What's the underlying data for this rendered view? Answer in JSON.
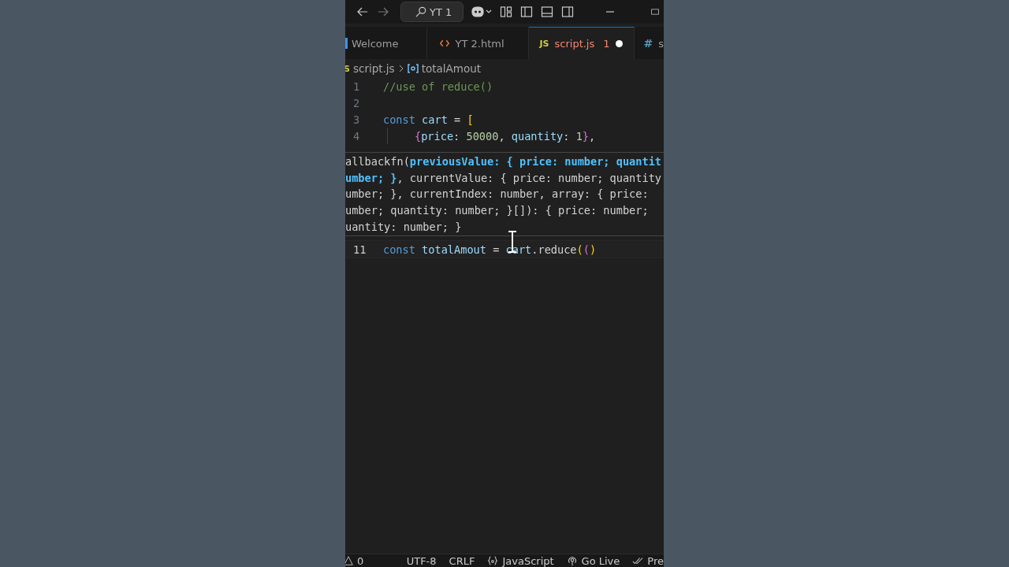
{
  "title_bar": {
    "search": "YT 1"
  },
  "tabs": [
    {
      "label": "Welcome",
      "kind": "welcome",
      "selected": false,
      "has_errors": false
    },
    {
      "label": "YT 2.html",
      "kind": "html",
      "selected": false,
      "has_errors": false
    },
    {
      "label": "script.js",
      "kind": "js",
      "icon_text": "JS",
      "selected": true,
      "has_errors": true,
      "problems": "1",
      "modified": true
    },
    {
      "label": "s",
      "kind": "css",
      "icon_text": "#",
      "selected": false,
      "has_errors": false
    }
  ],
  "breadcrumbs": [
    {
      "label": "script.js",
      "kind": "file",
      "icon_text": "S"
    },
    {
      "label": "totalAmout",
      "kind": "variable"
    }
  ],
  "code_top": [
    {
      "number": "1",
      "tokens": [
        {
          "text": "//use of reduce()",
          "kind": "comment"
        }
      ]
    },
    {
      "number": "2"
    },
    {
      "number": "3",
      "tokens": [
        {
          "text": "const ",
          "kind": "keyword"
        },
        {
          "text": "cart",
          "kind": "variable"
        },
        {
          "text": " = ",
          "kind": "plain"
        },
        {
          "text": "[",
          "kind": "bracket1"
        }
      ]
    },
    {
      "number": "4",
      "indent": true,
      "tokens": [
        {
          "text": "{",
          "kind": "bracket2"
        },
        {
          "text": "price",
          "kind": "variable"
        },
        {
          "text": ": ",
          "kind": "plain"
        },
        {
          "text": "50000",
          "kind": "number"
        },
        {
          "text": ", ",
          "kind": "plain"
        },
        {
          "text": "quantity",
          "kind": "variable"
        },
        {
          "text": ": ",
          "kind": "plain"
        },
        {
          "text": "1",
          "kind": "number"
        },
        {
          "text": "}",
          "kind": "bracket2"
        },
        {
          "text": ",",
          "kind": "plain"
        }
      ]
    }
  ],
  "hover": {
    "lines": [
      [
        {
          "text": "allbackfn(",
          "kind": "plain"
        },
        {
          "text": "previousValue: { price: number; quantit",
          "kind": "active"
        }
      ],
      [
        {
          "text": "umber; }",
          "kind": "active"
        },
        {
          "text": ", currentValue: { price: number; quantity",
          "kind": "plain"
        }
      ],
      [
        {
          "text": "umber; }, currentIndex: number, array: { price:",
          "kind": "plain"
        }
      ],
      [
        {
          "text": "umber; quantity: number; }[]): { price: number;",
          "kind": "plain"
        }
      ],
      [
        {
          "text": "uantity: number; }",
          "kind": "plain"
        }
      ]
    ]
  },
  "code_bottom": [
    {
      "number": "11",
      "active": true,
      "tokens": [
        {
          "text": "const ",
          "kind": "keyword"
        },
        {
          "text": "totalAmout",
          "kind": "variable"
        },
        {
          "text": " = ",
          "kind": "plain"
        },
        {
          "text": "cart",
          "kind": "variable"
        },
        {
          "text": ".reduce",
          "kind": "plain"
        },
        {
          "text": "(",
          "kind": "bracket1"
        },
        {
          "text": "(",
          "kind": "bracket2"
        },
        {
          "text": ")",
          "kind": "bracket1"
        }
      ]
    }
  ],
  "status_bar": [
    {
      "label": "0",
      "kind": "warnings"
    },
    {
      "label": "UTF-8",
      "kind": "text"
    },
    {
      "label": "CRLF",
      "kind": "text"
    },
    {
      "label": "JavaScript",
      "kind": "language"
    },
    {
      "label": "Go Live",
      "kind": "live"
    },
    {
      "label": "Pre",
      "kind": "prettier"
    }
  ]
}
